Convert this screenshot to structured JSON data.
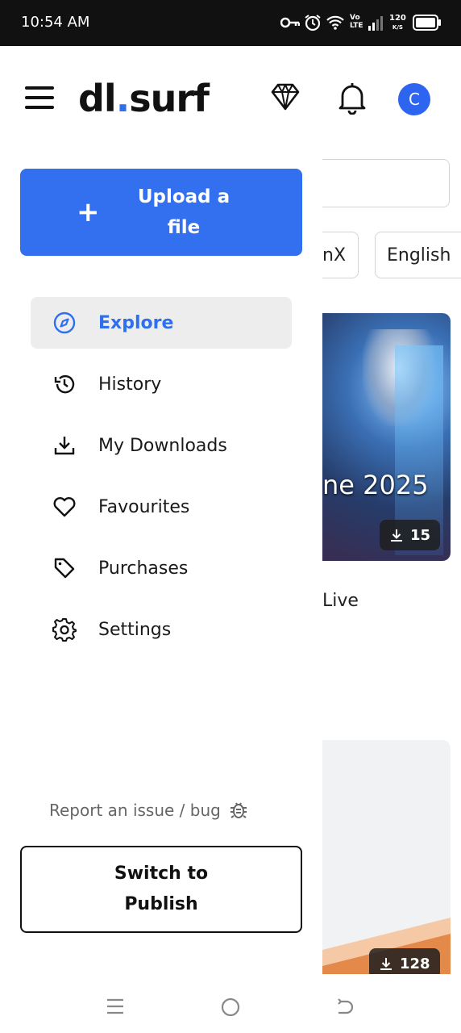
{
  "status_bar": {
    "time": "10:54 AM",
    "net_speed": "120",
    "net_unit": "K/S",
    "volte_top": "Vo",
    "volte_bottom": "LTE"
  },
  "header": {
    "logo_prefix": "dl",
    "logo_dot": ".",
    "logo_suffix": "surf",
    "avatar_initial": "C"
  },
  "drawer": {
    "upload_label": "Upload a file",
    "nav": [
      {
        "label": "Explore",
        "icon": "compass-icon",
        "active": true
      },
      {
        "label": "History",
        "icon": "history-icon"
      },
      {
        "label": "My Downloads",
        "icon": "download-icon"
      },
      {
        "label": "Favourites",
        "icon": "heart-icon"
      },
      {
        "label": "Purchases",
        "icon": "tag-icon"
      },
      {
        "label": "Settings",
        "icon": "gear-icon"
      }
    ],
    "report_label": "Report an issue / bug",
    "switch_label": "Switch to Publish"
  },
  "background": {
    "chip1": "nX",
    "chip2": "English",
    "card1_title": "ne 2025",
    "card1_downloads": "15",
    "card1_subtitle": "Live",
    "card2_downloads": "128"
  },
  "colors": {
    "accent": "#3370f0",
    "active_bg": "#ededed",
    "status_bar": "#111111"
  }
}
